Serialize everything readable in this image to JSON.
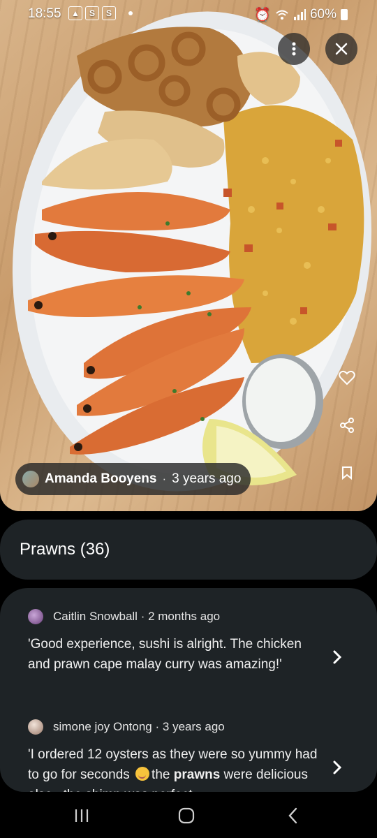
{
  "status_bar": {
    "time": "18:55",
    "icons_left": [
      "image-icon",
      "s-icon",
      "s-icon",
      "dot-icon"
    ],
    "icons_right": [
      "alarm-icon",
      "wifi-icon",
      "signal-icon",
      "battery-icon"
    ],
    "battery": "60%"
  },
  "photo": {
    "description_icons": [
      "more-icon",
      "close-icon",
      "heart-icon",
      "share-icon",
      "bookmark-icon"
    ],
    "author_name": "Amanda Booyens",
    "author_sep": "·",
    "author_time": "3 years ago"
  },
  "topic": {
    "label": "Prawns (36)"
  },
  "reviews": [
    {
      "author": "Caitlin Snowball",
      "sep": "·",
      "time": "2 months ago",
      "text": "'Good experience, sushi is alright. The chicken and prawn cape malay curry was amazing!'"
    },
    {
      "author": "simone joy Ontong",
      "sep": "·",
      "time": "3 years ago",
      "text_before": "'I ordered 12 oysters as they were so yummy had to go for seconds ",
      "highlight": "prawns",
      "text_mid": "the ",
      "text_after": " were delicious also...the shimp was perfect"
    }
  ],
  "colors": {
    "card_bg": "#1e2326",
    "page_bg": "#000000"
  }
}
